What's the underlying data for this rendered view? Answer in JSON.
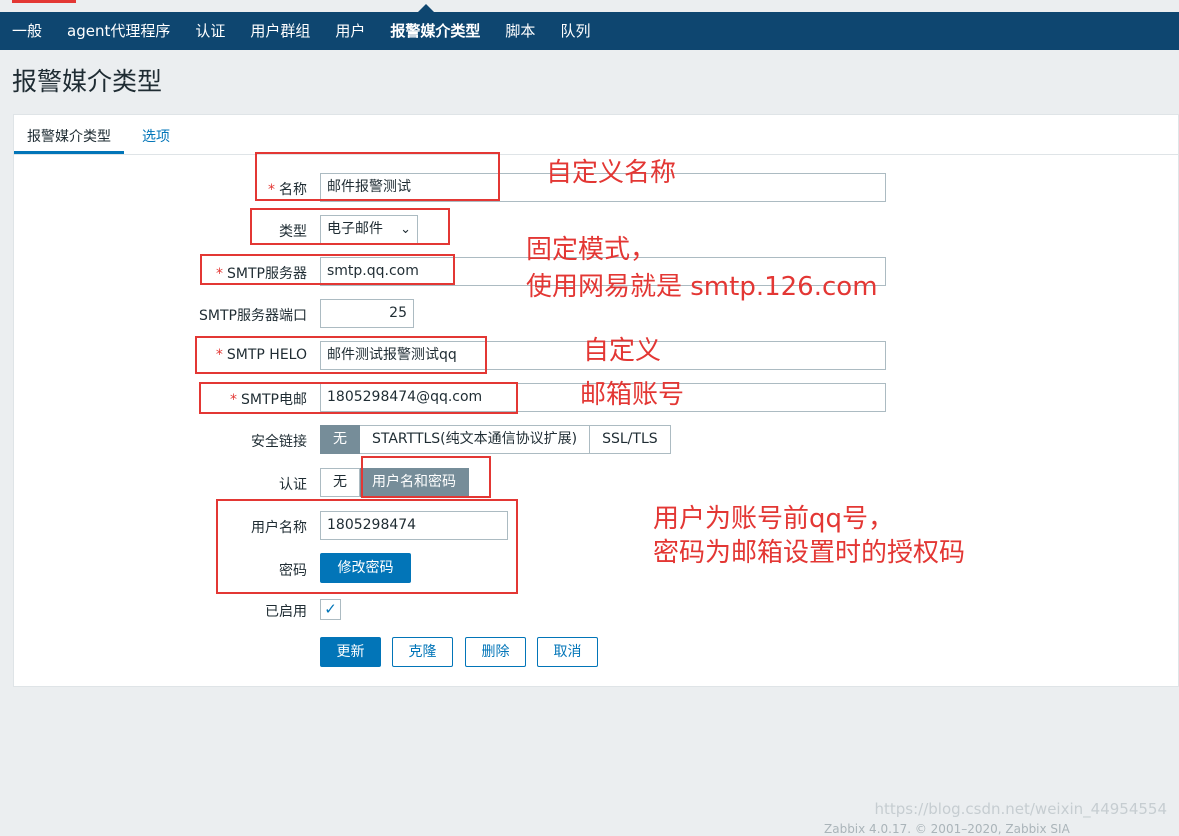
{
  "nav": {
    "items": [
      {
        "label": "一般"
      },
      {
        "label": "agent代理程序"
      },
      {
        "label": "认证"
      },
      {
        "label": "用户群组"
      },
      {
        "label": "用户"
      },
      {
        "label": "报警媒介类型",
        "active": true
      },
      {
        "label": "脚本"
      },
      {
        "label": "队列"
      }
    ]
  },
  "page": {
    "title": "报警媒介类型"
  },
  "tabs": {
    "main": "报警媒介类型",
    "options": "选项"
  },
  "form": {
    "name": {
      "label": "名称",
      "value": "邮件报警测试"
    },
    "type": {
      "label": "类型",
      "value": "电子邮件"
    },
    "smtp_server": {
      "label": "SMTP服务器",
      "value": "smtp.qq.com"
    },
    "smtp_port": {
      "label": "SMTP服务器端口",
      "value": "25"
    },
    "smtp_helo": {
      "label": "SMTP HELO",
      "value": "邮件测试报警测试qq"
    },
    "smtp_email": {
      "label": "SMTP电邮",
      "value": "1805298474@qq.com"
    },
    "security": {
      "label": "安全链接",
      "options": [
        "无",
        "STARTTLS(纯文本通信协议扩展)",
        "SSL/TLS"
      ],
      "selected": "无"
    },
    "auth": {
      "label": "认证",
      "options": [
        "无",
        "用户名和密码"
      ],
      "selected": "用户名和密码"
    },
    "username": {
      "label": "用户名称",
      "value": "1805298474"
    },
    "password": {
      "label": "密码",
      "button": "修改密码"
    },
    "enabled": {
      "label": "已启用",
      "checked": true
    }
  },
  "actions": {
    "update": "更新",
    "clone": "克隆",
    "delete": "删除",
    "cancel": "取消"
  },
  "annotations": {
    "name_note": "自定义名称",
    "server_note_line1": "固定模式，",
    "server_note_line2": "使用网易就是 smtp.126.com",
    "helo_note": "自定义",
    "email_note": "邮箱账号",
    "auth_note_line1": "用户为账号前qq号，",
    "auth_note_line2": "密码为邮箱设置时的授权码"
  },
  "watermark": "https://blog.csdn.net/weixin_44954554",
  "footer": "Zabbix 4.0.17. © 2001–2020, Zabbix SIA",
  "colors": {
    "nav_bg": "#0e4670",
    "accent": "#0275b8",
    "annotation": "#e33734",
    "segment_active": "#768d99"
  }
}
